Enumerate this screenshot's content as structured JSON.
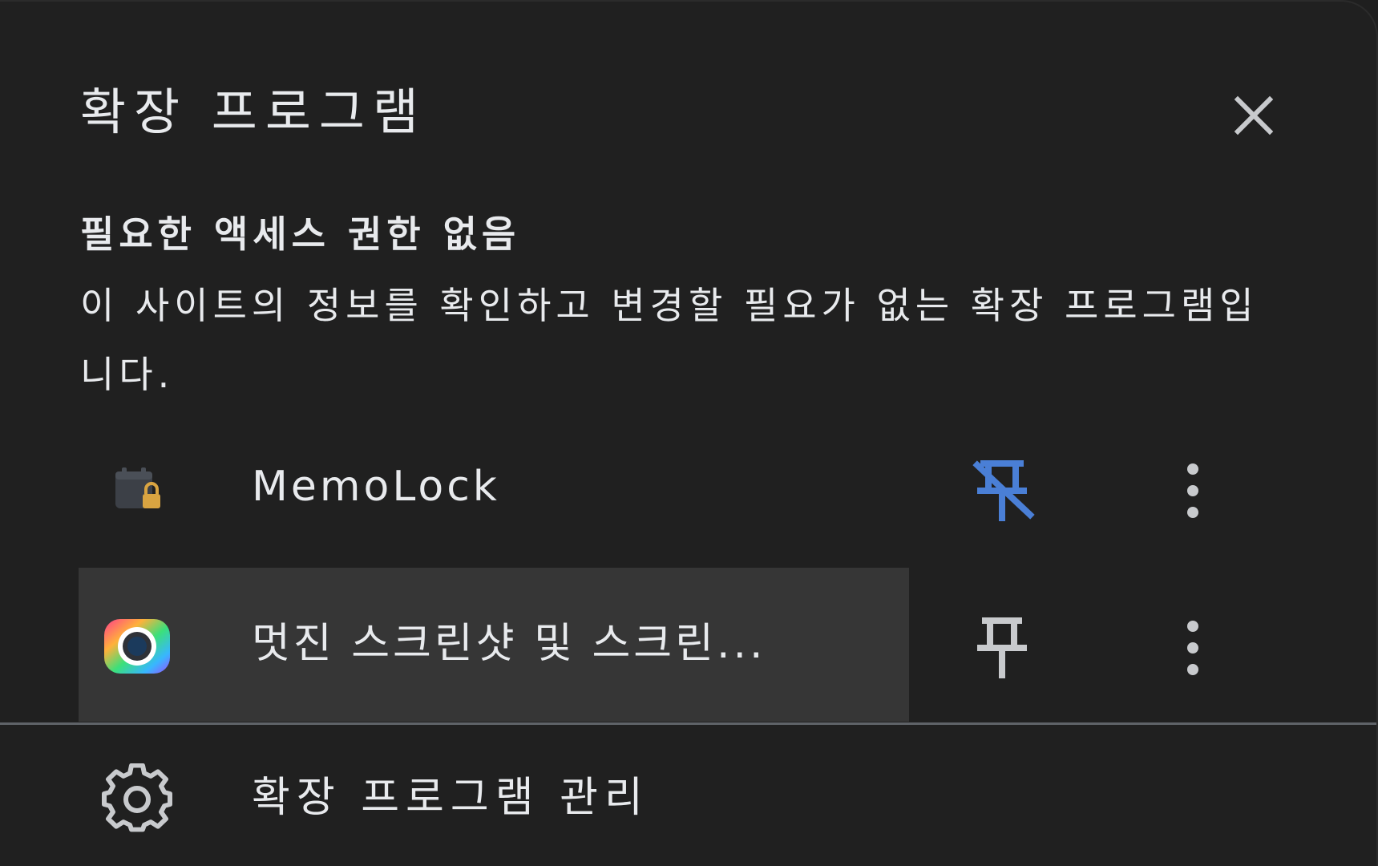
{
  "header": {
    "title": "확장 프로그램",
    "close_icon": "close-icon"
  },
  "section": {
    "heading": "필요한 액세스 권한 없음",
    "description": "이 사이트의 정보를 확인하고 변경할 필요가 없는 확장 프로그램입니다."
  },
  "extensions": [
    {
      "name": "MemoLock",
      "icon": "memolock-icon",
      "pinned": true,
      "pin_icon": "unpin-icon",
      "more_icon": "more-vert-icon"
    },
    {
      "name": "멋진 스크린샷 및 스크린...",
      "icon": "awesome-screenshot-icon",
      "pinned": false,
      "pin_icon": "pin-icon",
      "more_icon": "more-vert-icon",
      "highlighted": true
    }
  ],
  "footer": {
    "manage_label": "확장 프로그램 관리",
    "manage_icon": "gear-icon"
  },
  "colors": {
    "background": "#202020",
    "text": "#e8eaed",
    "accent": "#4a7fd6",
    "hover": "#363636",
    "divider": "#5f6368"
  }
}
